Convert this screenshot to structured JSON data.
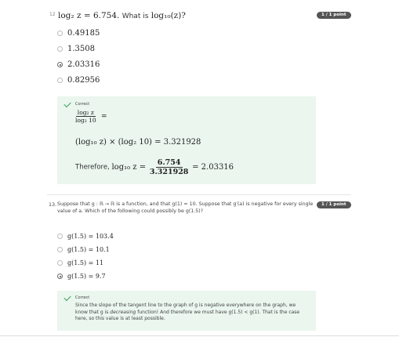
{
  "q12": {
    "number": "12",
    "question_prefix": "log₂ z = 6.754.",
    "question_text": "What is",
    "question_expr": "log₁₀(z)?",
    "badge": "1 / 1 point",
    "options": [
      "0.49185",
      "1.3508",
      "2.03316",
      "0.82956"
    ],
    "selected_index": 2,
    "feedback": {
      "status": "Correct",
      "frac_num": "log₂ z",
      "frac_den": "log₂ 10",
      "equals": "=",
      "line2": "(log₁₀ z) × (log₂ 10) = 3.321928",
      "therefore": "Therefore,",
      "line3_lhs": "log₁₀ z =",
      "line3_num": "6.754",
      "line3_den": "3.321928",
      "line3_rhs": "= 2.03316"
    }
  },
  "q13": {
    "number": "13.",
    "question_line1": "Suppose that g : ℝ → ℝ is a function, and that g(1) = 10. Suppose that g′(a) is negative for every single",
    "question_line2": "value of a. Which of the following could possibly be g(1.5)?",
    "badge": "1 / 1 point",
    "options": [
      "g(1.5) = 103.4",
      "g(1.5) = 10.1",
      "g(1.5) = 11",
      "g(1.5) = 9.7"
    ],
    "selected_index": 3,
    "feedback": {
      "status": "Correct",
      "line1": "Since the slope of the tangent line to the graph of g is negative everywhere on the graph, we",
      "line2_a": "know that g is",
      "line2_em": "decreasing",
      "line2_b": "function! And therefore we must have g(1.5) < g(1). That is the case",
      "line3": "here, so this value is at least possible."
    }
  },
  "icons": {
    "check": "check-icon",
    "radio": "radio-icon"
  },
  "colors": {
    "feedback_bg": "#eaf6ee",
    "check_green": "#3aa05a",
    "badge_bg": "#555555"
  }
}
